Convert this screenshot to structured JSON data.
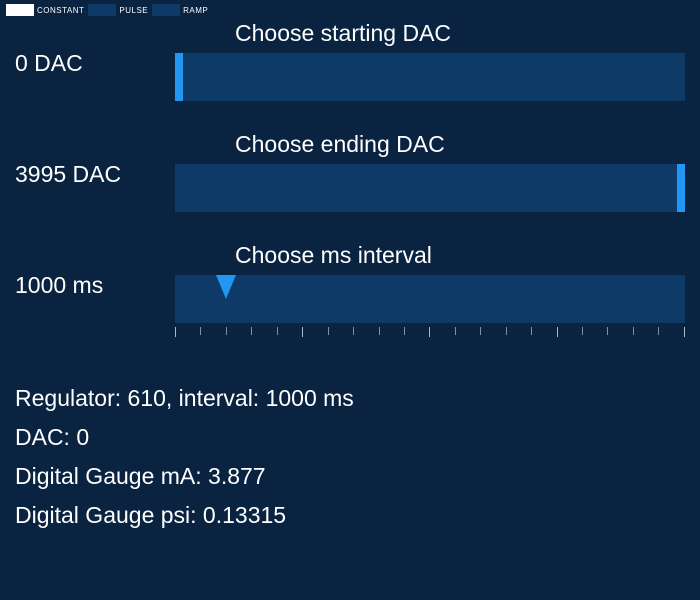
{
  "legend": {
    "constant": "CONSTANT",
    "pulse": "PULSE",
    "ramp": "RAMP"
  },
  "sliders": {
    "starting_dac": {
      "title": "Choose starting DAC",
      "value_text": "0 DAC",
      "value": 0,
      "min": 0,
      "max": 3995,
      "thumb_percent": 0
    },
    "ending_dac": {
      "title": "Choose ending DAC",
      "value_text": "3995 DAC",
      "value": 3995,
      "min": 0,
      "max": 3995,
      "thumb_percent": 98.5
    },
    "interval": {
      "title": "Choose ms interval",
      "value_text": "1000 ms",
      "value": 1000,
      "min": 0,
      "max": 10000,
      "thumb_percent": 10
    }
  },
  "status": {
    "regulator_line": "Regulator: 610, interval: 1000 ms",
    "dac_line": "DAC: 0",
    "gauge_ma_line": "Digital Gauge mA: 3.877",
    "gauge_psi_line": "Digital Gauge psi: 0.13315",
    "regulator": 610,
    "interval_ms": 1000,
    "dac": 0,
    "gauge_ma": 3.877,
    "gauge_psi": 0.13315
  }
}
